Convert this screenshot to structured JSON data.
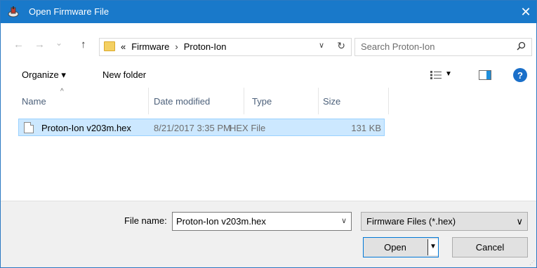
{
  "window": {
    "title": "Open Firmware File",
    "close_glyph": "✕"
  },
  "nav": {
    "back_glyph": "←",
    "forward_glyph": "→",
    "recent_glyph": "⌄",
    "up_glyph": "↑"
  },
  "address": {
    "overflow": "«",
    "crumbs": [
      "Firmware",
      "Proton-Ion"
    ],
    "separator": "›",
    "dropdown_glyph": "∨",
    "refresh_glyph": "↻"
  },
  "search": {
    "placeholder": "Search Proton-Ion",
    "icon": "search-icon"
  },
  "toolbar": {
    "organize_label": "Organize ▾",
    "new_folder_label": "New folder",
    "view_dropdown": "▼",
    "help_label": "?"
  },
  "columns": {
    "name": "Name",
    "date": "Date modified",
    "type": "Type",
    "size": "Size",
    "sort_indicator": "^"
  },
  "files": [
    {
      "name": "Proton-Ion v203m.hex",
      "date": "8/21/2017 3:35 PM",
      "type": "HEX File",
      "size": "131 KB",
      "selected": true
    }
  ],
  "footer": {
    "file_name_label": "File name:",
    "file_name_value": "Proton-Ion v203m.hex",
    "combo_arrow": "∨",
    "filter_value": "Firmware Files (*.hex)",
    "open_label": "Open",
    "open_split_glyph": "▼",
    "cancel_label": "Cancel"
  },
  "colors": {
    "titlebar": "#1979ca",
    "selection": "#cce8ff",
    "selection_border": "#99d1ff",
    "accent": "#0078d7"
  }
}
